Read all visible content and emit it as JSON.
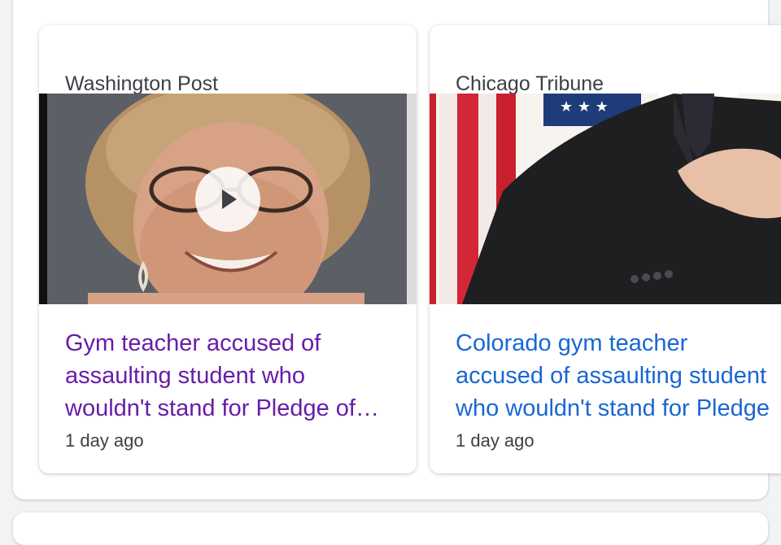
{
  "colors": {
    "visited_link": "#681da8",
    "link": "#1967d2",
    "meta_text": "#3c4043",
    "card_bg": "#ffffff",
    "page_bg": "#f1f3f4"
  },
  "stories": [
    {
      "source": "Washington Post",
      "headline": "Gym teacher accused of assaulting student who wouldn't stand for Pledge of Allegiance",
      "age": "1 day ago",
      "has_video": true,
      "thumbnail": "photo of smiling woman with glasses",
      "play_icon": "play-icon"
    },
    {
      "source": "Chicago Tribune",
      "headline": "Colorado gym teacher accused of assaulting student who wouldn't stand for Pledge",
      "age": "1 day ago",
      "has_video": false,
      "thumbnail": "man in suit with hand over heart in front of American flag"
    }
  ]
}
